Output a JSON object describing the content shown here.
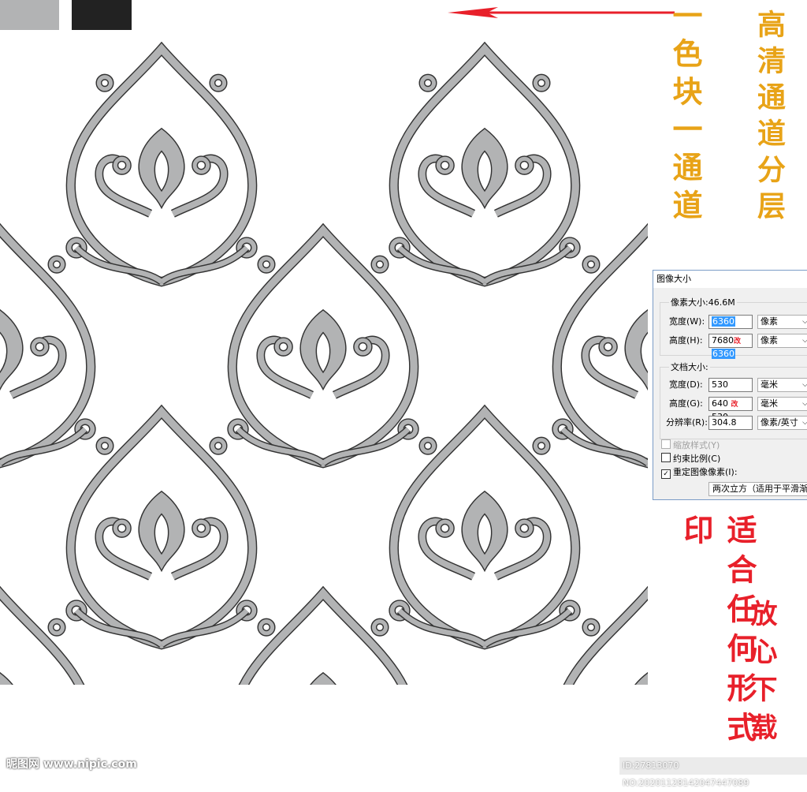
{
  "swatches": {
    "gray": "#b2b3b4",
    "black": "#222222"
  },
  "colors": {
    "arrow": "#e8202a",
    "gold_text": "#e8a317",
    "red_text": "#e8202a",
    "pattern_fill": "#b2b3b4",
    "pattern_stroke": "#333333"
  },
  "callouts": {
    "left_top": "一色块一通道",
    "right_top": "高清通道分层",
    "left_bottom": "适合任何形式印",
    "right_bottom": "放心下载"
  },
  "dialog": {
    "title": "图像大小",
    "pixel_dimensions": {
      "label": "像素大小:46.6M",
      "width_label": "宽度(W):",
      "width_value": "6360",
      "width_unit": "像素",
      "height_label": "高度(H):",
      "height_value": "7680",
      "height_value_new": "6360",
      "height_unit": "像素"
    },
    "document_size": {
      "label": "文档大小:",
      "width_label": "宽度(D):",
      "width_value": "530",
      "width_unit": "毫米",
      "height_label": "高度(G):",
      "height_value": "640",
      "height_value_new": "530",
      "height_unit": "毫米",
      "resolution_label": "分辨率(R):",
      "resolution_value": "304.8",
      "resolution_unit": "像素/英寸"
    },
    "options": {
      "scale_styles": "缩放样式(Y)",
      "constrain": "约束比例(C)",
      "resample": "重定图像像素(I):"
    },
    "resample_method": "两次立方（适用于平滑渐变",
    "mark": "改"
  },
  "watermarks": {
    "left": "昵图网 www.nipic.com",
    "right": "ID:27813070 NO:20201128142047447089"
  }
}
